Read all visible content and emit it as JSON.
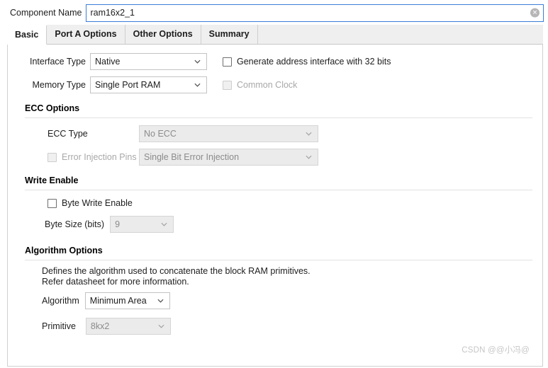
{
  "component_name": {
    "label": "Component Name",
    "value": "ram16x2_1",
    "placeholder": "",
    "clear_glyph": "✕"
  },
  "tabs": [
    {
      "label": "Basic",
      "active": true
    },
    {
      "label": "Port A Options",
      "active": false
    },
    {
      "label": "Other Options",
      "active": false
    },
    {
      "label": "Summary",
      "active": false
    }
  ],
  "basic": {
    "interface_type": {
      "label": "Interface Type",
      "value": "Native"
    },
    "memory_type": {
      "label": "Memory Type",
      "value": "Single Port RAM"
    },
    "generate_address_interface": {
      "label": "Generate address interface with 32 bits",
      "checked": false,
      "enabled": true
    },
    "common_clock": {
      "label": "Common Clock",
      "checked": false,
      "enabled": false
    }
  },
  "ecc_options": {
    "title": "ECC Options",
    "ecc_type": {
      "label": "ECC Type",
      "value": "No ECC",
      "enabled": false
    },
    "error_injection_pins": {
      "label": "Error Injection Pins",
      "checked": false,
      "enabled": false
    },
    "error_injection_type": {
      "value": "Single Bit Error Injection",
      "enabled": false
    }
  },
  "write_enable": {
    "title": "Write Enable",
    "byte_write_enable": {
      "label": "Byte Write Enable",
      "checked": false,
      "enabled": true
    },
    "byte_size": {
      "label": "Byte Size (bits)",
      "value": "9",
      "enabled": false
    }
  },
  "algorithm_options": {
    "title": "Algorithm Options",
    "description_line1": "Defines the algorithm used to concatenate the block RAM primitives.",
    "description_line2": "Refer datasheet for more information.",
    "algorithm": {
      "label": "Algorithm",
      "value": "Minimum Area",
      "enabled": true
    },
    "primitive": {
      "label": "Primitive",
      "value": "8kx2",
      "enabled": false
    }
  },
  "watermark": "CSDN @@小冯@",
  "colors": {
    "focus_border": "#3b7dd8",
    "tab_inactive_bg": "#efefef",
    "disabled_fill": "#ebebeb",
    "disabled_text": "#8b8b8b"
  }
}
